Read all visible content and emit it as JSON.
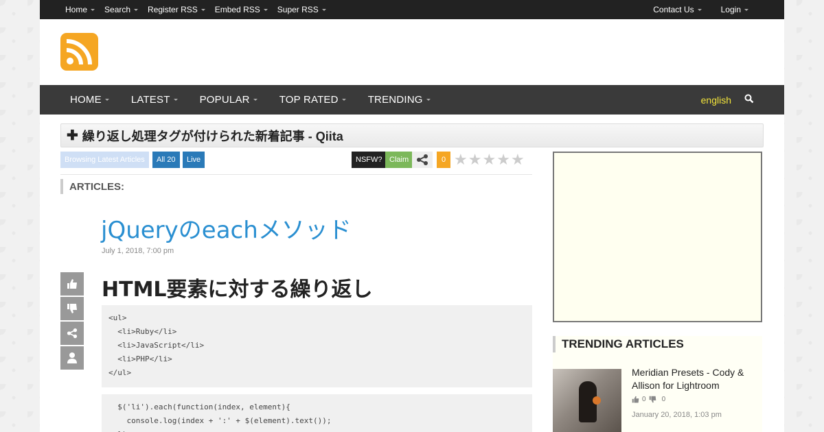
{
  "topbar": {
    "items": [
      "Home",
      "Search",
      "Register RSS",
      "Embed RSS",
      "Super RSS"
    ],
    "right": [
      "Contact Us",
      "Login"
    ]
  },
  "mainnav": {
    "items": [
      "HOME",
      "LATEST",
      "POPULAR",
      "TOP RATED",
      "TRENDING"
    ],
    "language": "english"
  },
  "page": {
    "title": "繰り返し処理タグが付けられた新着記事 - Qiita"
  },
  "toolbar": {
    "browsing": "Browsing Latest Articles",
    "all": "All 20",
    "live": "Live",
    "nsfw": "NSFW?",
    "claim": "Claim",
    "count": "0"
  },
  "rating": {
    "stars_filled": 0,
    "stars_total": 5
  },
  "articles_heading": "ARTICLES:",
  "article": {
    "title": "jQueryのeachメソッド",
    "date": "July 1, 2018, 7:00 pm",
    "heading": "HTML要素に対する繰り返し",
    "code1": "<ul>\n  <li>Ruby</li>\n  <li>JavaScript</li>\n  <li>PHP</li>\n</ul>",
    "code2": "  $('li').each(function(index, element){\n    console.log(index + ':' + $(element).text());\n  });"
  },
  "sidebar": {
    "trending_heading": "TRENDING ARTICLES",
    "trending": [
      {
        "title": "Meridian Presets - Cody & Allison for Lightroom",
        "likes": "0",
        "dislikes": "0",
        "date": "January 20, 2018, 1:03 pm"
      }
    ]
  },
  "colors": {
    "logo": "#f5a623",
    "link": "#2a8fd1",
    "language": "#f3e43a",
    "all_btn": "#2a7ab8",
    "claim_btn": "#7cb85a",
    "count_badge": "#f5a623"
  }
}
